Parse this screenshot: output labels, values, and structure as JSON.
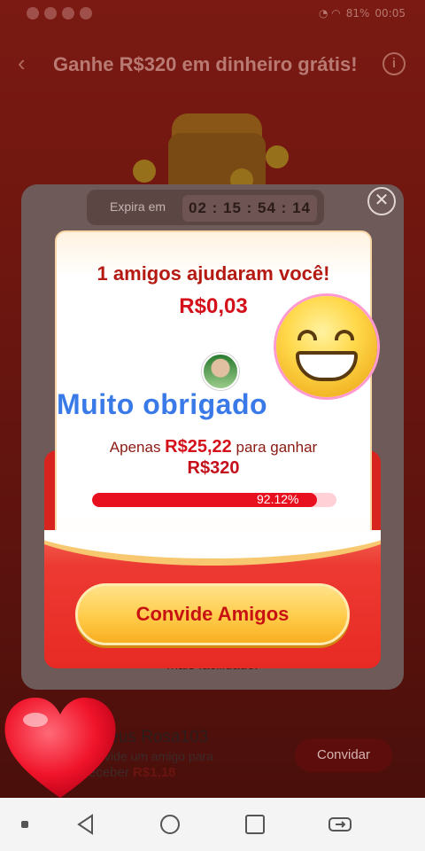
{
  "status_bar": {
    "time": "00:05",
    "battery": "81%"
  },
  "header": {
    "title": "Ganhe R$320 em dinheiro grátis!"
  },
  "countdown": {
    "label": "Expira em",
    "time": "02 : 15 : 54 : 14"
  },
  "popup": {
    "title": "1 amigos ajudaram você!",
    "amount": "R$0,03",
    "thanks": "Muito obrigado",
    "progress_prefix": "Apenas ",
    "progress_amount": "R$25,22",
    "progress_suffix": " para ganhar",
    "goal": "R$320",
    "progress_percent_label": "92.12%",
    "progress_fraction": 0.9212,
    "invite_button": "Convide Amigos"
  },
  "background": {
    "description_line2": "mais facilidade!",
    "user_name": "teus Rosa103",
    "user_sub": "vide um amigo para",
    "user_reward_prefix": "eceber ",
    "user_reward": "R$1,18",
    "invite_button": "Convidar"
  },
  "colors": {
    "accent": "#e8101e",
    "button_gold": "#ffcc4a",
    "link_blue": "#3a7ae8"
  },
  "icons": [
    "back-arrow-icon",
    "info-icon",
    "close-icon",
    "grinning-emoji-icon",
    "heart-icon",
    "nav-back-icon",
    "nav-home-icon",
    "nav-recents-icon",
    "nav-switch-icon"
  ]
}
